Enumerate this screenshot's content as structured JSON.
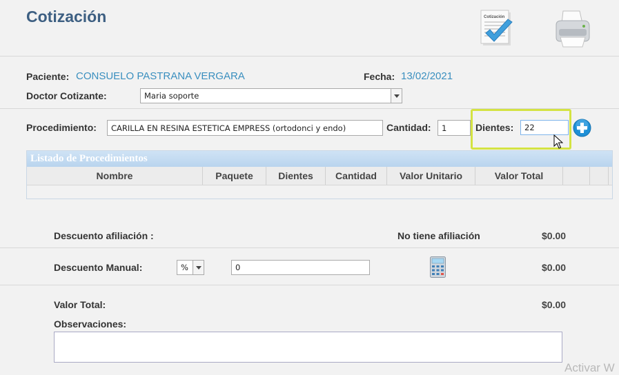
{
  "page": {
    "title": "Cotización"
  },
  "toolbar": {
    "quote_icon_caption": "Cotización"
  },
  "patient": {
    "label": "Paciente:",
    "name": "CONSUELO PASTRANA VERGARA",
    "date_label": "Fecha:",
    "date": "13/02/2021"
  },
  "doctor": {
    "label": "Doctor Cotizante:",
    "selected": "Maria soporte"
  },
  "procedure": {
    "label": "Procedimiento:",
    "value": "CARILLA EN RESINA ESTETICA EMPRESS (ortodonci y endo)",
    "qty_label": "Cantidad:",
    "qty_value": "1",
    "teeth_label": "Dientes:",
    "teeth_value": "22"
  },
  "grid": {
    "caption": "Listado de Procedimientos",
    "columns": [
      "Nombre",
      "Paquete",
      "Dientes",
      "Cantidad",
      "Valor Unitario",
      "Valor Total",
      "",
      ""
    ]
  },
  "summary": {
    "affiliation_label": "Descuento afiliación :",
    "affiliation_status": "No tiene afiliación",
    "affiliation_amount": "$0.00",
    "manual_label": "Descuento Manual:",
    "manual_type": "%",
    "manual_value": "0",
    "manual_amount": "$0.00",
    "total_label": "Valor Total:",
    "total_amount": "$0.00",
    "notes_label": "Observaciones:"
  },
  "colors": {
    "title": "#3d5f82",
    "link": "#3a8fbf",
    "highlight": "#d4e342",
    "add": "#1e8fd6"
  },
  "watermark": "Activar W"
}
